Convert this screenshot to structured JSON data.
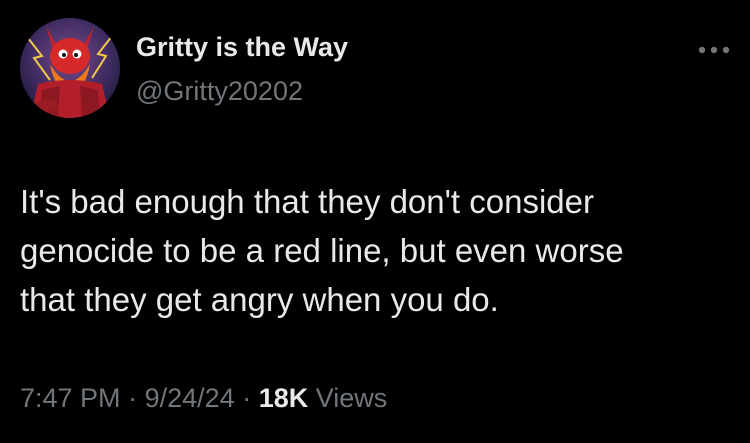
{
  "author": {
    "display_name": "Gritty is the Way",
    "handle": "@Gritty20202",
    "avatar_icon": "gritty-mascot-avatar"
  },
  "menu": {
    "icon": "more-horizontal-icon"
  },
  "tweet": {
    "text": "It's bad enough that they don't consider\ngenocide to be a red line, but even worse\nthat they get angry when you do."
  },
  "meta": {
    "time": "7:47 PM",
    "separator": "·",
    "date": "9/24/24",
    "views_count": "18K",
    "views_label": "Views"
  },
  "colors": {
    "background": "#000000",
    "primary_text": "#e7e9ea",
    "secondary_text": "#71767b"
  }
}
